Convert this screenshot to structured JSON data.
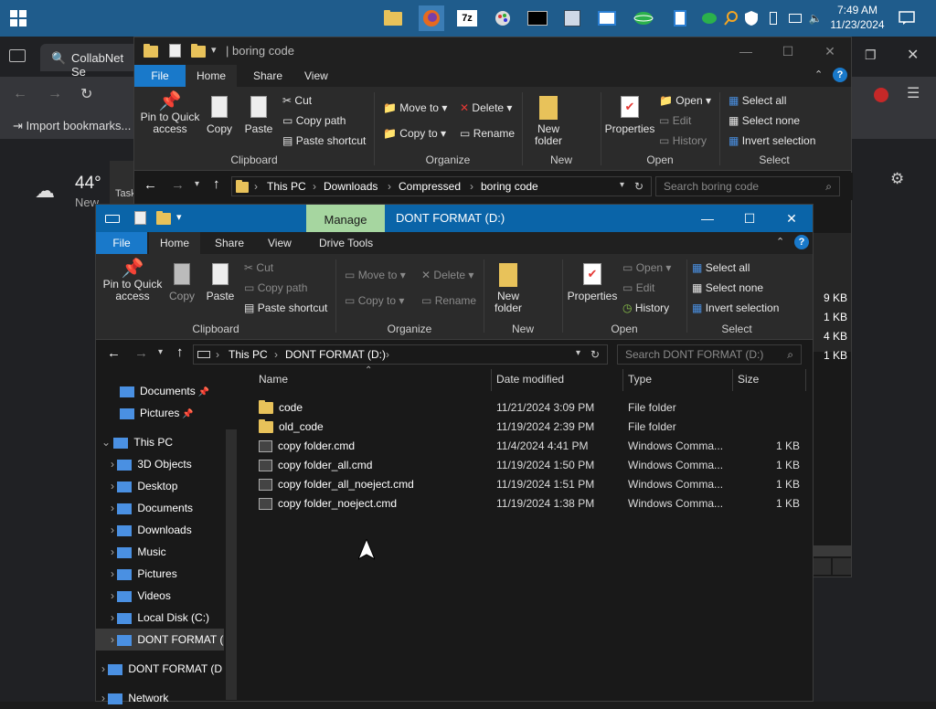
{
  "taskbar": {
    "clock_time": "7:49 AM",
    "clock_date": "11/23/2024"
  },
  "browser": {
    "tab_title": "CollabNet Se",
    "bookmark": "Import bookmarks...",
    "weather_temp": "44°",
    "weather_label": "New",
    "task_label": "Task",
    "sizes": [
      "9 KB",
      "1 KB",
      "4 KB",
      "1 KB"
    ]
  },
  "back_window": {
    "title": "boring code",
    "tabs": [
      "File",
      "Home",
      "Share",
      "View"
    ],
    "ribbon": {
      "pin": "Pin to Quick access",
      "copy": "Copy",
      "paste": "Paste",
      "cut": "Cut",
      "copy_path": "Copy path",
      "paste_shortcut": "Paste shortcut",
      "move_to": "Move to",
      "copy_to": "Copy to",
      "delete": "Delete",
      "rename": "Rename",
      "new_folder": "New folder",
      "properties": "Properties",
      "open": "Open",
      "edit": "Edit",
      "history": "History",
      "select_all": "Select all",
      "select_none": "Select none",
      "invert_selection": "Invert selection",
      "groups": [
        "Clipboard",
        "Organize",
        "New",
        "Open",
        "Select"
      ]
    },
    "address": [
      "This PC",
      "Downloads",
      "Compressed",
      "boring code"
    ],
    "search_placeholder": "Search boring code"
  },
  "front_window": {
    "title": "DONT FORMAT (D:)",
    "context_tab": "Manage",
    "tabs": [
      "File",
      "Home",
      "Share",
      "View",
      "Drive Tools"
    ],
    "ribbon": {
      "pin": "Pin to Quick access",
      "copy": "Copy",
      "paste": "Paste",
      "cut": "Cut",
      "copy_path": "Copy path",
      "paste_shortcut": "Paste shortcut",
      "move_to": "Move to",
      "copy_to": "Copy to",
      "delete": "Delete",
      "rename": "Rename",
      "new_folder": "New folder",
      "properties": "Properties",
      "open": "Open",
      "edit": "Edit",
      "history": "History",
      "select_all": "Select all",
      "select_none": "Select none",
      "invert_selection": "Invert selection",
      "groups": [
        "Clipboard",
        "Organize",
        "New",
        "Open",
        "Select"
      ]
    },
    "address": [
      "This PC",
      "DONT FORMAT (D:)"
    ],
    "search_placeholder": "Search DONT FORMAT (D:)",
    "nav": [
      {
        "label": "Documents",
        "indent": 1
      },
      {
        "label": "Pictures",
        "indent": 1
      },
      {
        "label": "This PC",
        "indent": 0
      },
      {
        "label": "3D Objects",
        "indent": 1
      },
      {
        "label": "Desktop",
        "indent": 1
      },
      {
        "label": "Documents",
        "indent": 1
      },
      {
        "label": "Downloads",
        "indent": 1
      },
      {
        "label": "Music",
        "indent": 1
      },
      {
        "label": "Pictures",
        "indent": 1
      },
      {
        "label": "Videos",
        "indent": 1
      },
      {
        "label": "Local Disk (C:)",
        "indent": 1
      },
      {
        "label": "DONT FORMAT (",
        "indent": 1
      },
      {
        "label": "DONT FORMAT (D",
        "indent": 0
      },
      {
        "label": "Network",
        "indent": 0
      }
    ],
    "columns": [
      "Name",
      "Date modified",
      "Type",
      "Size"
    ],
    "files": [
      {
        "name": "code",
        "date": "11/21/2024 3:09 PM",
        "type": "File folder",
        "size": "",
        "kind": "folder"
      },
      {
        "name": "old_code",
        "date": "11/19/2024 2:39 PM",
        "type": "File folder",
        "size": "",
        "kind": "folder"
      },
      {
        "name": "copy folder.cmd",
        "date": "11/4/2024 4:41 PM",
        "type": "Windows Comma...",
        "size": "1 KB",
        "kind": "cmd"
      },
      {
        "name": "copy folder_all.cmd",
        "date": "11/19/2024 1:50 PM",
        "type": "Windows Comma...",
        "size": "1 KB",
        "kind": "cmd"
      },
      {
        "name": "copy folder_all_noeject.cmd",
        "date": "11/19/2024 1:51 PM",
        "type": "Windows Comma...",
        "size": "1 KB",
        "kind": "cmd"
      },
      {
        "name": "copy folder_noeject.cmd",
        "date": "11/19/2024 1:38 PM",
        "type": "Windows Comma...",
        "size": "1 KB",
        "kind": "cmd"
      }
    ]
  }
}
